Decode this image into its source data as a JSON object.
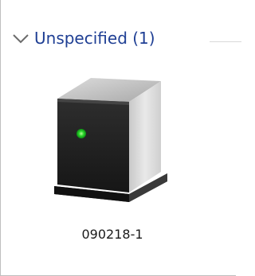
{
  "group": {
    "title": "Unspecified (1)",
    "expanded": true
  },
  "devices": [
    {
      "name": "090218-1",
      "icon": "computer-tower-icon",
      "status_light_color": "#2bd62b"
    }
  ],
  "colors": {
    "group_title": "#1f3f94",
    "chevron": "#6b6b6b",
    "divider": "#d9d9d9"
  }
}
